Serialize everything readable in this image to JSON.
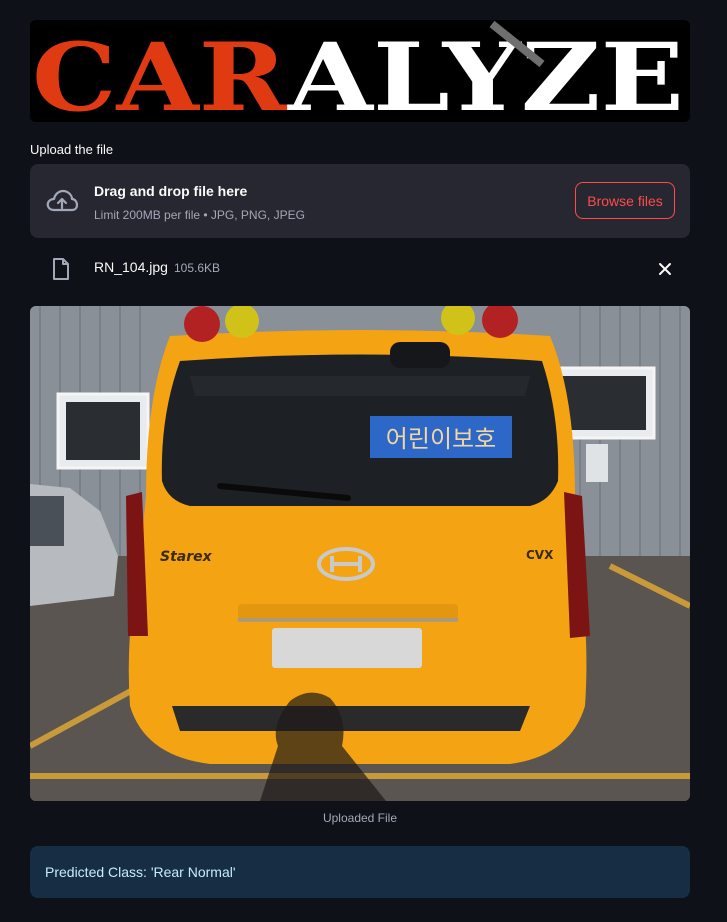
{
  "logo": {
    "text_red": "CAR",
    "text_white": "ALYZE",
    "red_color": "#e03a12",
    "white_color": "#ffffff"
  },
  "uploader": {
    "label": "Upload the file",
    "drop_title": "Drag and drop file here",
    "limit_text": "Limit 200MB per file • JPG, PNG, JPEG",
    "browse_label": "Browse files",
    "accent_color": "#ff4b4b"
  },
  "uploaded_file": {
    "name": "RN_104.jpg",
    "size": "105.6KB"
  },
  "image": {
    "caption": "Uploaded File",
    "sign_text": "어린이보호",
    "badge_left": "Starex",
    "badge_right": "CVX"
  },
  "result": {
    "text": "Predicted Class: 'Rear Normal'"
  }
}
